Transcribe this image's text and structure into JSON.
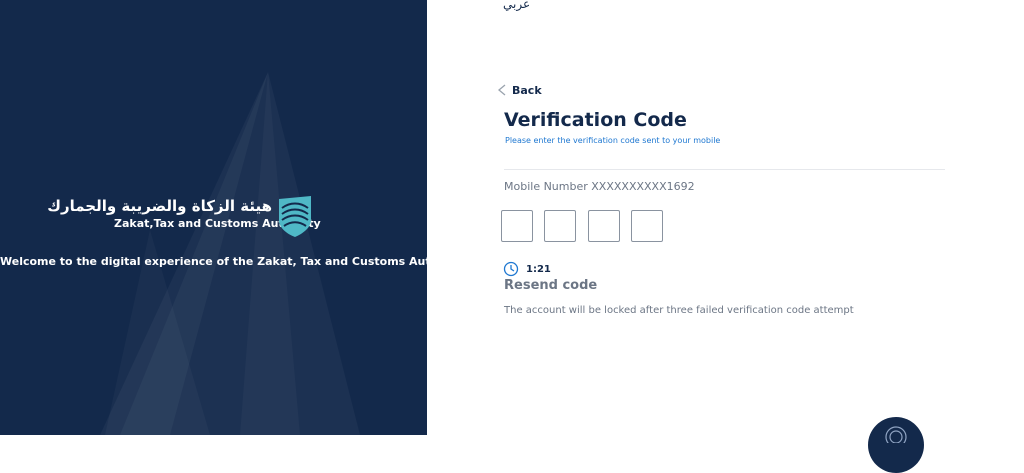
{
  "brand": {
    "name_ar": "هيئة الزكاة والضريبة والجمارك",
    "name_en": "Zakat,Tax and Customs Authority",
    "welcome": "Welcome to the digital experience of the Zakat, Tax and Customs Authority"
  },
  "header": {
    "language_toggle": "عربي"
  },
  "form": {
    "back_label": "Back",
    "title": "Verification Code",
    "subtitle": "Please enter the verification code sent to your mobile",
    "mobile_text": "Mobile Number XXXXXXXXXX1692",
    "code_inputs": [
      "",
      "",
      "",
      ""
    ],
    "timer": "1:21",
    "resend_label": "Resend code",
    "lock_note": "The account will be locked after three failed verification code attempt"
  },
  "colors": {
    "navy": "#13294b",
    "link_blue": "#1f78d1",
    "muted_text": "#6c7685",
    "logo_teal": "#4fb8c6"
  },
  "icons": {
    "back": "chevron-left-icon",
    "timer": "clock-icon",
    "logo": "zatca-shield-logo-icon",
    "fab": "support-icon"
  }
}
